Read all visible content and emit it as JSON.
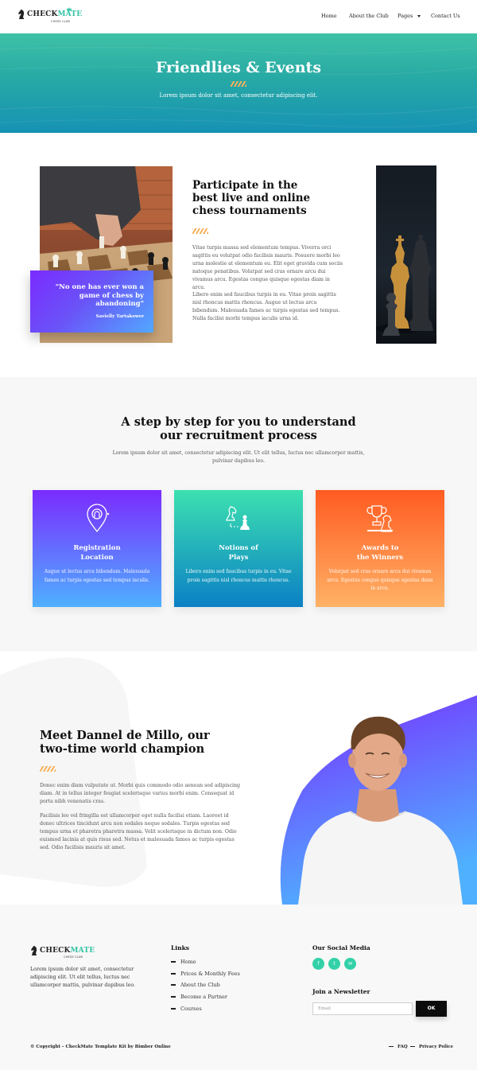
{
  "brand": {
    "name_part1": "CHECK",
    "name_part2": "MATE",
    "tagline": "CHESS CLUB"
  },
  "nav": {
    "items": [
      "Home",
      "About the Club",
      "Pages",
      "Contact Us"
    ]
  },
  "hero": {
    "title": "Friendlies & Events",
    "subtitle": "Lorem ipsum dolor sit amet, consectetur adipiscing elit."
  },
  "intro": {
    "quote": "\"No one has ever won a game of chess by abandoning\"",
    "quote_author": "Savielly Tartakower",
    "heading": "Participate in the best live and online chess tournaments",
    "para1": "Vitae turpis massa sed elementum tempus. Viverra orci sagittis eu volutpat odio facilisis mauris. Posuere morbi leo urna molestie at elementum eu. Elit eget gravida cum sociis natoque penatibus. Volutpat sed cras ornare arcu dui vivamus arcu. Egestas congue quisque egestas diam in arcu.",
    "para2": "Libero enim sed faucibus turpis in eu. Vitae proin sagittis nisl rhoncus mattis rhoncus. Augue ut lectus arcu bibendum. Malesuada fames ac turpis egestas sed tempus. Nulla facilisi morbi tempus iaculis urna id."
  },
  "steps": {
    "heading": "A step by step for you to understand our recruitment process",
    "subtitle": "Lorem ipsum dolor sit amet, consectetur adipiscing elit. Ut elit tellus, luctus nec ullamcorper mattis, pulvinar dapibus leo.",
    "cards": [
      {
        "title_line1": "Registration",
        "title_line2": "Location",
        "text": "Augue ut lectus arcu bibendum. Malesuada fames ac turpis egestas sed tempus iaculis.",
        "icon": "location-pin-icon",
        "gradient": [
          "#7a2bff",
          "#4fb0ff"
        ]
      },
      {
        "title_line1": "Notions of",
        "title_line2": "Plays",
        "text": "Libero enim sed faucibus turpis in eu. Vitae proin sagittis nisl rhoncus mattis rhoncus.",
        "icon": "chess-pieces-icon",
        "gradient": [
          "#3ce1b0",
          "#0b80c5"
        ]
      },
      {
        "title_line1": "Awards to",
        "title_line2": "the Winners",
        "text": "Volutpat sed cras ornare arcu dui vivamus arcu. Egestas congue quisque egestas diam in arcu.",
        "icon": "trophy-icon",
        "gradient": [
          "#ff5b21",
          "#ffb266"
        ]
      }
    ]
  },
  "champion": {
    "heading": "Meet Dannel de Millo, our two-time world champion",
    "para1": "Donec enim diam vulputate ut. Morbi quis commodo odio aenean sed adipiscing diam. At in tellus integer feugiat scelerisque varius morbi enim. Consequat id porta nibh venenatis cras.",
    "para2": "Facilisis leo vel fringilla est ullamcorper eget nulla facilisi etiam. Laoreet id donec ultrices tincidunt arcu non sodales neque sodales. Turpis egestas sed tempus urna et pharetra pharetra massa. Velit scelerisque in dictum non. Odio euismod lacinia at quis risus sed. Netus et malesuada fames ac turpis egestas sed. Odio facilisis mauris sit amet."
  },
  "footer": {
    "about": "Lorem ipsum dolor sit amet, consectetur adipiscing elit. Ut elit tellus, luctus nec ullamcorper mattis, pulvinar dapibus leo.",
    "links_heading": "Links",
    "links": [
      "Home",
      "Prices & Monthly Fees",
      "About the Club",
      "Become a Partner",
      "Courses"
    ],
    "social_heading": "Our Social Media",
    "social": [
      "facebook-icon",
      "twitter-icon",
      "email-icon"
    ],
    "newsletter_heading": "Join a Newsletter",
    "email_placeholder": "Email",
    "ok_label": "OK",
    "copyright": "© Copyright – CheckMate Template Kit by Bimber Online",
    "bottom_links": [
      "FAQ",
      "Privacy Police"
    ]
  },
  "colors": {
    "accent": "#33c3a4",
    "stripe": "#f6b25a",
    "purple": "#7a2bff",
    "blue": "#4fb0ff"
  }
}
